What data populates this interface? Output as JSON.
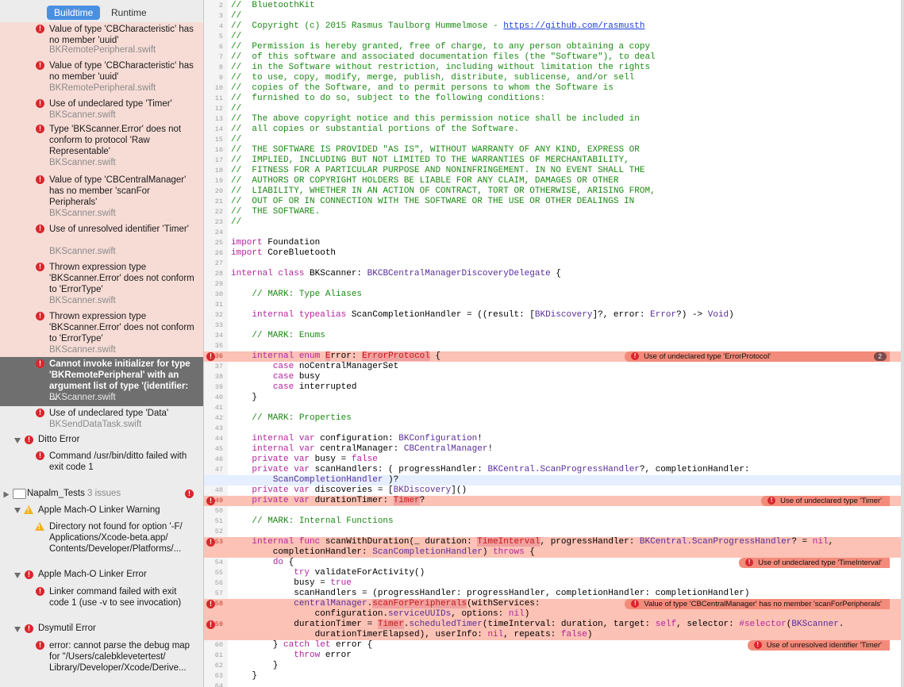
{
  "navigator": {
    "tabs": [
      {
        "label": "Buildtime",
        "active": true
      },
      {
        "label": "Runtime",
        "active": false
      }
    ],
    "issues": [
      {
        "type": "error",
        "msg": "Value of type 'CBCharacteristic' has no member 'uuid'",
        "file": "BKRemotePeripheral.swift",
        "highlight": true
      },
      {
        "type": "error",
        "msg": "Value of type 'CBCharacteristic' has no member 'uuid'",
        "file": "BKRemotePeripheral.swift",
        "highlight": true
      },
      {
        "type": "error",
        "msg": "Use of undeclared type 'Timer'",
        "file": "BKScanner.swift",
        "highlight": true
      },
      {
        "type": "error",
        "msg": "Type 'BKScanner.Error' does not conform to protocol 'Raw Representable'",
        "file": "BKScanner.swift",
        "highlight": true
      },
      {
        "type": "error",
        "msg": "Value of type 'CBCentralManager' has no member 'scanFor Peripherals'",
        "file": "BKScanner.swift",
        "highlight": true
      },
      {
        "type": "error",
        "msg": "Use of unresolved identifier 'Timer'",
        "file": "BKScanner.swift",
        "highlight": true
      },
      {
        "type": "error",
        "msg": "Thrown expression type 'BKScanner.Error' does not conform to 'ErrorType'",
        "file": "BKScanner.swift",
        "highlight": true
      },
      {
        "type": "error",
        "msg": "Thrown expression type 'BKScanner.Error' does not conform to 'ErrorType'",
        "file": "BKScanner.swift",
        "highlight": true
      },
      {
        "type": "error",
        "msg": "Cannot invoke initializer for type 'BKRemotePeripheral' with an argument list of type '(identifier: ...",
        "file": "BKScanner.swift",
        "selected": true
      },
      {
        "type": "error",
        "msg": "Use of undeclared type 'Data'",
        "file": "BKSendDataTask.swift"
      }
    ],
    "ditto_group": {
      "label": "Ditto Error",
      "issue": "Command /usr/bin/ditto failed with exit code 1"
    },
    "project": {
      "name": "Napalm_Tests",
      "count": "3 issues"
    },
    "linker_warning": {
      "label": "Apple Mach-O Linker Warning",
      "issue": "Directory not found for option '-F/ Applications/Xcode-beta.app/ Contents/Developer/Platforms/..."
    },
    "linker_error": {
      "label": "Apple Mach-O Linker Error",
      "issue": "Linker command failed with exit code 1 (use -v to see invocation)"
    },
    "dsymutil": {
      "label": "Dsymutil Error",
      "issue": "error: cannot parse the debug map for \"/Users/calebklevetertest/ Library/Developer/Xcode/Derive..."
    }
  },
  "editor": {
    "lines": [
      {
        "n": "2",
        "segs": [
          [
            "c",
            "//  BluetoothKit"
          ]
        ]
      },
      {
        "n": "3",
        "segs": [
          [
            "c",
            "//"
          ]
        ]
      },
      {
        "n": "4",
        "segs": [
          [
            "c",
            "//  Copyright (c) 2015 Rasmus Taulborg Hummelmose - "
          ],
          [
            "l",
            "https://github.com/rasmusth"
          ]
        ]
      },
      {
        "n": "5",
        "segs": [
          [
            "c",
            "//"
          ]
        ]
      },
      {
        "n": "6",
        "segs": [
          [
            "c",
            "//  Permission is hereby granted, free of charge, to any person obtaining a copy"
          ]
        ]
      },
      {
        "n": "7",
        "segs": [
          [
            "c",
            "//  of this software and associated documentation files (the \"Software\"), to deal"
          ]
        ]
      },
      {
        "n": "8",
        "segs": [
          [
            "c",
            "//  in the Software without restriction, including without limitation the rights"
          ]
        ]
      },
      {
        "n": "9",
        "segs": [
          [
            "c",
            "//  to use, copy, modify, merge, publish, distribute, sublicense, and/or sell"
          ]
        ]
      },
      {
        "n": "10",
        "segs": [
          [
            "c",
            "//  copies of the Software, and to permit persons to whom the Software is"
          ]
        ]
      },
      {
        "n": "11",
        "segs": [
          [
            "c",
            "//  furnished to do so, subject to the following conditions:"
          ]
        ]
      },
      {
        "n": "12",
        "segs": [
          [
            "c",
            "//"
          ]
        ]
      },
      {
        "n": "13",
        "segs": [
          [
            "c",
            "//  The above copyright notice and this permission notice shall be included in"
          ]
        ]
      },
      {
        "n": "14",
        "segs": [
          [
            "c",
            "//  all copies or substantial portions of the Software."
          ]
        ]
      },
      {
        "n": "15",
        "segs": [
          [
            "c",
            "//"
          ]
        ]
      },
      {
        "n": "16",
        "segs": [
          [
            "c",
            "//  THE SOFTWARE IS PROVIDED \"AS IS\", WITHOUT WARRANTY OF ANY KIND, EXPRESS OR"
          ]
        ]
      },
      {
        "n": "17",
        "segs": [
          [
            "c",
            "//  IMPLIED, INCLUDING BUT NOT LIMITED TO THE WARRANTIES OF MERCHANTABILITY,"
          ]
        ]
      },
      {
        "n": "18",
        "segs": [
          [
            "c",
            "//  FITNESS FOR A PARTICULAR PURPOSE AND NONINFRINGEMENT. IN NO EVENT SHALL THE"
          ]
        ]
      },
      {
        "n": "19",
        "segs": [
          [
            "c",
            "//  AUTHORS OR COPYRIGHT HOLDERS BE LIABLE FOR ANY CLAIM, DAMAGES OR OTHER"
          ]
        ]
      },
      {
        "n": "20",
        "segs": [
          [
            "c",
            "//  LIABILITY, WHETHER IN AN ACTION OF CONTRACT, TORT OR OTHERWISE, ARISING FROM,"
          ]
        ]
      },
      {
        "n": "21",
        "segs": [
          [
            "c",
            "//  OUT OF OR IN CONNECTION WITH THE SOFTWARE OR THE USE OR OTHER DEALINGS IN"
          ]
        ]
      },
      {
        "n": "22",
        "segs": [
          [
            "c",
            "//  THE SOFTWARE."
          ]
        ]
      },
      {
        "n": "23",
        "segs": [
          [
            "c",
            "//"
          ]
        ]
      },
      {
        "n": "24",
        "segs": []
      },
      {
        "n": "25",
        "segs": [
          [
            "k",
            "import"
          ],
          [
            "p",
            " Foundation"
          ]
        ]
      },
      {
        "n": "26",
        "segs": [
          [
            "k",
            "import"
          ],
          [
            "p",
            " CoreBluetooth"
          ]
        ]
      },
      {
        "n": "27",
        "segs": []
      },
      {
        "n": "28",
        "segs": [
          [
            "k",
            "internal class"
          ],
          [
            "p",
            " BKScanner: "
          ],
          [
            "t",
            "BKCBCentralManagerDiscoveryDelegate"
          ],
          [
            "p",
            " {"
          ]
        ]
      },
      {
        "n": "29",
        "segs": []
      },
      {
        "n": "30",
        "segs": [
          [
            "c",
            "    // MARK: Type Aliases"
          ]
        ]
      },
      {
        "n": "31",
        "segs": []
      },
      {
        "n": "32",
        "segs": [
          [
            "p",
            "    "
          ],
          [
            "k",
            "internal typealias"
          ],
          [
            "p",
            " ScanCompletionHandler = ((result: ["
          ],
          [
            "t",
            "BKDiscovery"
          ],
          [
            "p",
            "]?, error: "
          ],
          [
            "t",
            "Error"
          ],
          [
            "p",
            "?) -> "
          ],
          [
            "t",
            "Void"
          ],
          [
            "p",
            ")"
          ]
        ]
      },
      {
        "n": "33",
        "segs": []
      },
      {
        "n": "34",
        "segs": [
          [
            "c",
            "    // MARK: Enums"
          ]
        ]
      },
      {
        "n": "35",
        "segs": []
      },
      {
        "n": "36",
        "hl": true,
        "err": "Use of undeclared type 'ErrorProtocol'",
        "count": "2",
        "segs": [
          [
            "p",
            "    "
          ],
          [
            "k",
            "internal enum"
          ],
          [
            "p",
            " "
          ],
          [
            "e",
            "E"
          ],
          [
            "p",
            "rror: "
          ],
          [
            "e",
            "ErrorProtocol"
          ],
          [
            "p",
            " {"
          ]
        ]
      },
      {
        "n": "37",
        "segs": [
          [
            "p",
            "        "
          ],
          [
            "k",
            "case"
          ],
          [
            "p",
            " noCentralManagerSet"
          ]
        ]
      },
      {
        "n": "38",
        "segs": [
          [
            "p",
            "        "
          ],
          [
            "k",
            "case"
          ],
          [
            "p",
            " busy"
          ]
        ]
      },
      {
        "n": "39",
        "segs": [
          [
            "p",
            "        "
          ],
          [
            "k",
            "case"
          ],
          [
            "p",
            " interrupted"
          ]
        ]
      },
      {
        "n": "40",
        "segs": [
          [
            "p",
            "    }"
          ]
        ]
      },
      {
        "n": "41",
        "segs": []
      },
      {
        "n": "42",
        "segs": [
          [
            "c",
            "    // MARK: Properties"
          ]
        ]
      },
      {
        "n": "43",
        "segs": []
      },
      {
        "n": "44",
        "segs": [
          [
            "p",
            "    "
          ],
          [
            "k",
            "internal var"
          ],
          [
            "p",
            " configuration: "
          ],
          [
            "t",
            "BKConfiguration"
          ],
          [
            "p",
            "!"
          ]
        ]
      },
      {
        "n": "45",
        "segs": [
          [
            "p",
            "    "
          ],
          [
            "k",
            "internal var"
          ],
          [
            "p",
            " centralManager: "
          ],
          [
            "t",
            "CBCentralManager"
          ],
          [
            "p",
            "!"
          ]
        ]
      },
      {
        "n": "46",
        "segs": [
          [
            "p",
            "    "
          ],
          [
            "k",
            "private var"
          ],
          [
            "p",
            " busy = "
          ],
          [
            "k",
            "false"
          ]
        ]
      },
      {
        "n": "47",
        "segs": [
          [
            "p",
            "    "
          ],
          [
            "k",
            "private var"
          ],
          [
            "p",
            " scanHandlers: ( progressHandler: "
          ],
          [
            "t",
            "BKCentral.ScanProgressHandler"
          ],
          [
            "p",
            "?, completionHandler:"
          ]
        ]
      },
      {
        "n": "",
        "cur": true,
        "segs": [
          [
            "p",
            "        "
          ],
          [
            "t",
            "ScanCompletionHandler"
          ],
          [
            "p",
            " )?"
          ]
        ]
      },
      {
        "n": "48",
        "segs": [
          [
            "p",
            "    "
          ],
          [
            "k",
            "private var"
          ],
          [
            "p",
            " discoveries = ["
          ],
          [
            "t",
            "BKDiscovery"
          ],
          [
            "p",
            "]()"
          ]
        ]
      },
      {
        "n": "49",
        "hl": true,
        "err": "Use of undeclared type 'Timer'",
        "segs": [
          [
            "p",
            "    "
          ],
          [
            "k",
            "private var"
          ],
          [
            "p",
            " durationTimer: "
          ],
          [
            "e",
            "Timer"
          ],
          [
            "p",
            "?"
          ]
        ]
      },
      {
        "n": "50",
        "segs": []
      },
      {
        "n": "51",
        "segs": [
          [
            "c",
            "    // MARK: Internal Functions"
          ]
        ]
      },
      {
        "n": "52",
        "segs": []
      },
      {
        "n": "53",
        "hl": true,
        "segs": [
          [
            "p",
            "    "
          ],
          [
            "k",
            "internal func"
          ],
          [
            "p",
            " scanWithDuration(_ duration: "
          ],
          [
            "e",
            "TimeInterval"
          ],
          [
            "p",
            ", progressHandler: "
          ],
          [
            "t",
            "BKCentral.ScanProgressHandler"
          ],
          [
            "p",
            "? = "
          ],
          [
            "k",
            "nil"
          ],
          [
            "p",
            ","
          ]
        ]
      },
      {
        "n": "",
        "hl": true,
        "segs": [
          [
            "p",
            "        completionHandler: "
          ],
          [
            "t",
            "ScanCompletionHandler"
          ],
          [
            "p",
            ") "
          ],
          [
            "k",
            "throws"
          ],
          [
            "p",
            " {"
          ]
        ]
      },
      {
        "n": "54",
        "err": "Use of undeclared type 'TimeInterval'",
        "segs": [
          [
            "p",
            "        "
          ],
          [
            "k",
            "do"
          ],
          [
            "p",
            " {"
          ]
        ]
      },
      {
        "n": "55",
        "segs": [
          [
            "p",
            "            "
          ],
          [
            "k",
            "try"
          ],
          [
            "p",
            " validateForActivity()"
          ]
        ]
      },
      {
        "n": "56",
        "segs": [
          [
            "p",
            "            busy = "
          ],
          [
            "k",
            "true"
          ]
        ]
      },
      {
        "n": "57",
        "segs": [
          [
            "p",
            "            scanHandlers = (progressHandler: progressHandler, completionHandler: completionHandler)"
          ]
        ]
      },
      {
        "n": "58",
        "hl": true,
        "err": "Value of type 'CBCentralManager' has no member 'scanForPeripherals'",
        "segs": [
          [
            "p",
            "            "
          ],
          [
            "t",
            "centralManager"
          ],
          [
            "p",
            "."
          ],
          [
            "e",
            "scanForPeripherals"
          ],
          [
            "p",
            "(withServices:"
          ]
        ]
      },
      {
        "n": "",
        "hl": true,
        "segs": [
          [
            "p",
            "                configuration."
          ],
          [
            "t",
            "serviceUUIDs"
          ],
          [
            "p",
            ", options: "
          ],
          [
            "k",
            "nil"
          ],
          [
            "p",
            ")"
          ]
        ]
      },
      {
        "n": "59",
        "hl": true,
        "segs": [
          [
            "p",
            "            durationTimer = "
          ],
          [
            "e",
            "Timer"
          ],
          [
            "p",
            "."
          ],
          [
            "t",
            "scheduledTimer"
          ],
          [
            "p",
            "(timeInterval: duration, target: "
          ],
          [
            "k",
            "self"
          ],
          [
            "p",
            ", selector: "
          ],
          [
            "k",
            "#selector"
          ],
          [
            "p",
            "("
          ],
          [
            "t",
            "BKScanner"
          ],
          [
            "p",
            "."
          ]
        ]
      },
      {
        "n": "",
        "hl": true,
        "segs": [
          [
            "p",
            "                durationTimerElapsed), userInfo: "
          ],
          [
            "k",
            "nil"
          ],
          [
            "p",
            ", repeats: "
          ],
          [
            "k",
            "false"
          ],
          [
            "p",
            ")"
          ]
        ]
      },
      {
        "n": "60",
        "err": "Use of unresolved identifier 'Timer'",
        "segs": [
          [
            "p",
            "        } "
          ],
          [
            "k",
            "catch let"
          ],
          [
            "p",
            " error {"
          ]
        ]
      },
      {
        "n": "61",
        "segs": [
          [
            "p",
            "            "
          ],
          [
            "k",
            "throw"
          ],
          [
            "p",
            " error"
          ]
        ]
      },
      {
        "n": "62",
        "segs": [
          [
            "p",
            "        }"
          ]
        ]
      },
      {
        "n": "63",
        "segs": [
          [
            "p",
            "    }"
          ]
        ]
      },
      {
        "n": "64",
        "segs": []
      }
    ]
  }
}
